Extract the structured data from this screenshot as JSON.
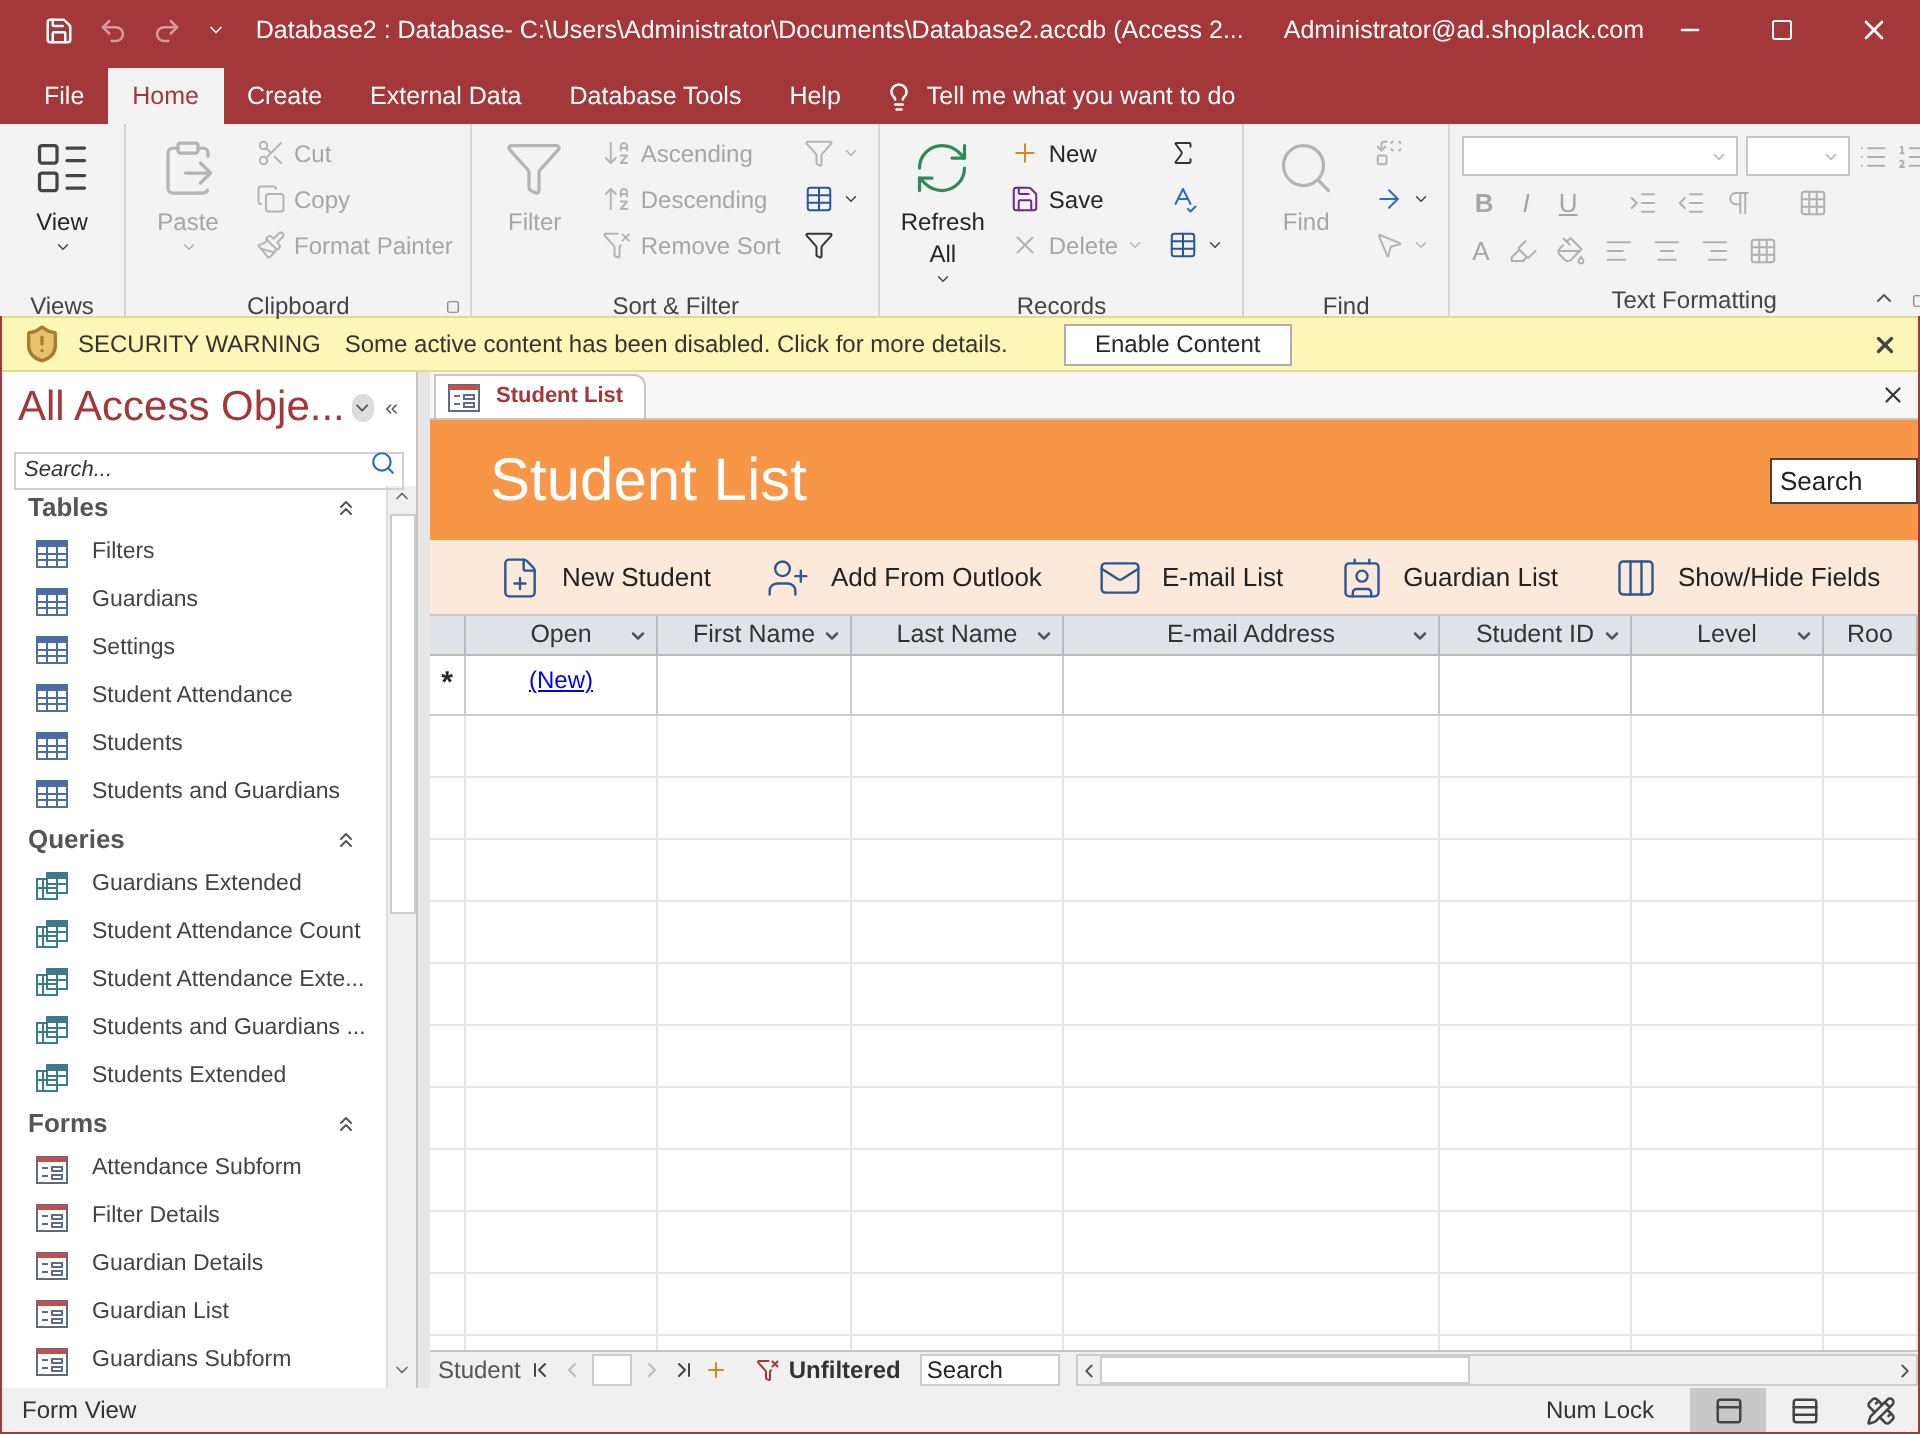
{
  "title_bar": {
    "title": "Database2 : Database- C:\\Users\\Administrator\\Documents\\Database2.accdb (Access 2...",
    "user": "Administrator@ad.shoplack.com",
    "quick_access": [
      {
        "kind": "save",
        "disabled": false
      },
      {
        "kind": "undo",
        "disabled": true
      },
      {
        "kind": "redo",
        "disabled": true
      }
    ]
  },
  "menu_tabs": [
    {
      "label": "File",
      "selected": false
    },
    {
      "label": "Home",
      "selected": true
    },
    {
      "label": "Create",
      "selected": false
    },
    {
      "label": "External Data",
      "selected": false
    },
    {
      "label": "Database Tools",
      "selected": false
    },
    {
      "label": "Help",
      "selected": false
    }
  ],
  "tell_me": "Tell me what you want to do",
  "ribbon": {
    "groups": [
      {
        "label": "Views",
        "launcher": false,
        "large": {
          "kind": "view",
          "label": "View",
          "dropdown": true,
          "disabled": false
        }
      },
      {
        "label": "Clipboard",
        "launcher": true,
        "large": {
          "kind": "paste",
          "label": "Paste",
          "dropdown": true,
          "disabled": true
        },
        "columns": [
          [
            {
              "kind": "cut",
              "label": "Cut",
              "dropdown": false,
              "disabled": true
            },
            {
              "kind": "copy",
              "label": "Copy",
              "dropdown": false,
              "disabled": true
            },
            {
              "kind": "format-painter",
              "label": "Format Painter",
              "dropdown": false,
              "disabled": true
            }
          ]
        ]
      },
      {
        "label": "Sort & Filter",
        "launcher": false,
        "large": {
          "kind": "filter",
          "label": "Filter",
          "dropdown": false,
          "disabled": true
        },
        "columns": [
          [
            {
              "kind": "ascending",
              "label": "Ascending",
              "dropdown": false,
              "disabled": true
            },
            {
              "kind": "descending",
              "label": "Descending",
              "dropdown": false,
              "disabled": true
            },
            {
              "kind": "remove-sort",
              "label": "Remove Sort",
              "dropdown": false,
              "disabled": true
            }
          ],
          [
            {
              "kind": "selection",
              "dropdown": true,
              "disabled": true
            },
            {
              "kind": "advanced",
              "dropdown": true,
              "disabled": false
            },
            {
              "kind": "toggle-filter",
              "dropdown": false,
              "disabled": false
            }
          ]
        ]
      },
      {
        "label": "Records",
        "launcher": false,
        "large": {
          "kind": "refresh",
          "label": "Refresh All",
          "dropdown": true,
          "disabled": false
        },
        "columns": [
          [
            {
              "kind": "new",
              "label": "New",
              "dropdown": false,
              "disabled": false
            },
            {
              "kind": "save",
              "label": "Save",
              "dropdown": false,
              "disabled": false
            },
            {
              "kind": "delete",
              "label": "Delete",
              "dropdown": true,
              "disabled": true
            }
          ],
          [
            {
              "kind": "totals",
              "dropdown": false,
              "disabled": false
            },
            {
              "kind": "spelling",
              "dropdown": false,
              "disabled": false
            },
            {
              "kind": "more",
              "dropdown": true,
              "disabled": false
            }
          ]
        ]
      },
      {
        "label": "Find",
        "launcher": false,
        "large": {
          "kind": "find",
          "label": "Find",
          "dropdown": false,
          "disabled": true
        },
        "columns": [
          [
            {
              "kind": "replace",
              "dropdown": false,
              "disabled": true
            },
            {
              "kind": "go-to",
              "dropdown": true,
              "disabled": false
            },
            {
              "kind": "select",
              "dropdown": true,
              "disabled": true
            }
          ]
        ]
      }
    ],
    "text_formatting": {
      "label": "Text Formatting",
      "launcher": true,
      "style_buttons": [
        {
          "label": "B",
          "disabled": true
        },
        {
          "label": "I",
          "disabled": true
        },
        {
          "label": "U",
          "disabled": true
        }
      ],
      "font_color": {
        "label": "A",
        "disabled": true
      }
    }
  },
  "security_bar": {
    "title": "SECURITY WARNING",
    "message": "Some active content has been disabled. Click for more details.",
    "button": "Enable Content"
  },
  "navigation": {
    "title": "All Access Obje...",
    "placeholder": "Search...",
    "groups": [
      {
        "label": "Tables",
        "kind": "table",
        "items": [
          "Filters",
          "Guardians",
          "Settings",
          "Student Attendance",
          "Students",
          "Students and Guardians"
        ]
      },
      {
        "label": "Queries",
        "kind": "query",
        "items": [
          "Guardians Extended",
          "Student Attendance Count",
          "Student Attendance Exte...",
          "Students and Guardians ...",
          "Students Extended"
        ]
      },
      {
        "label": "Forms",
        "kind": "form",
        "items": [
          "Attendance Subform",
          "Filter Details",
          "Guardian Details",
          "Guardian List",
          "Guardians Subform"
        ]
      }
    ]
  },
  "document_tab": {
    "label": "Student List",
    "selected": true
  },
  "form": {
    "title": "Student List",
    "search_placeholder": "Search",
    "commands": [
      {
        "kind": "new-student",
        "label": "New Student"
      },
      {
        "kind": "outlook",
        "label": "Add From Outlook"
      },
      {
        "kind": "email",
        "label": "E-mail List"
      },
      {
        "kind": "guardian",
        "label": "Guardian List"
      },
      {
        "kind": "fields",
        "label": "Show/Hide Fields"
      }
    ],
    "columns": [
      {
        "label": "Open",
        "dropdown": true
      },
      {
        "label": "First Name",
        "dropdown": true
      },
      {
        "label": "Last Name",
        "dropdown": true
      },
      {
        "label": "E-mail Address",
        "dropdown": true
      },
      {
        "label": "Student ID",
        "dropdown": true
      },
      {
        "label": "Level",
        "dropdown": true
      },
      {
        "label": "Roo",
        "dropdown": false
      }
    ],
    "new_row": {
      "selector": "*",
      "link": "(New)"
    },
    "record_nav": {
      "label": "Student",
      "filter": "Unfiltered",
      "search_placeholder": "Search"
    }
  },
  "status_bar": {
    "text": "Form View",
    "indicators": [
      "Num Lock"
    ],
    "views": [
      {
        "kind": "form",
        "selected": true
      },
      {
        "kind": "datasheet",
        "selected": false
      },
      {
        "kind": "layout",
        "selected": false
      }
    ]
  }
}
